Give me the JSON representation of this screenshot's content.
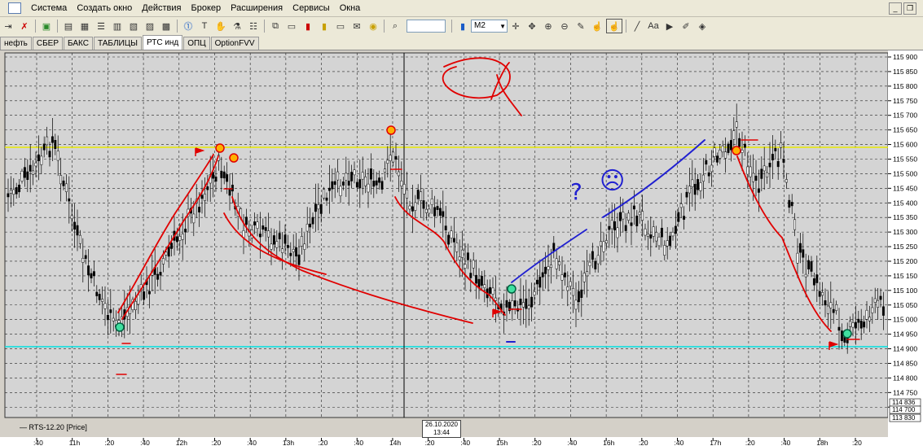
{
  "menu": [
    "Система",
    "Создать окно",
    "Действия",
    "Брокер",
    "Расширения",
    "Сервисы",
    "Окна"
  ],
  "toolbar": {
    "timeframe": "M2",
    "search_value": ""
  },
  "tabs": [
    "нефть",
    "СБЕР",
    "БАКС",
    "ТАБЛИЦЫ",
    "РТС инд",
    "ОПЦ",
    "OptionFVV"
  ],
  "active_tab": "РТС инд",
  "legend": "RTS-12.20 [Price]",
  "crosshair": {
    "date": "26.10.2020",
    "time": "13:44"
  },
  "yaxis_labels": [
    "115 900",
    "115 850",
    "115 800",
    "115 750",
    "115 700",
    "115 650",
    "115 600",
    "115 550",
    "115 500",
    "115 450",
    "115 400",
    "115 350",
    "115 300",
    "115 250",
    "115 200",
    "115 150",
    "115 100",
    "115 050",
    "115 000",
    "114 950",
    "114 900",
    "114 850",
    "114 800",
    "114 750",
    "114 700"
  ],
  "price_badges": [
    "114 836",
    "114 700",
    "113 830"
  ],
  "xaxis_labels": [
    ":40",
    "11h",
    ":20",
    ":40",
    "12h",
    ":20",
    ":40",
    "13h",
    ":20",
    ":40",
    "14h",
    ":20",
    ":40",
    "15h",
    ":20",
    ":40",
    "16h",
    ":20",
    ":40",
    "17h",
    ":20",
    ":40",
    "18h",
    ":20"
  ],
  "colors": {
    "chart_bg": "#d4d4d4",
    "yellow_line": "#e8e800",
    "cyan_line": "#00e0e0",
    "red_ink": "#e00000",
    "blue_ink": "#2020d0"
  },
  "icons": {
    "question_glyph": "?",
    "sad_glyph": "☹"
  }
}
